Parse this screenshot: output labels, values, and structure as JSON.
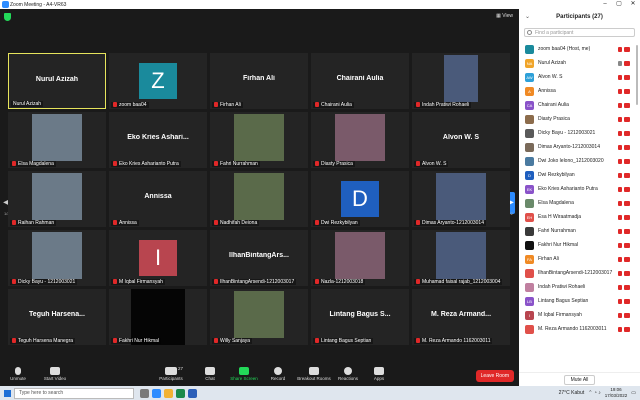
{
  "window": {
    "title": "Zoom Meeting - A4-VR63",
    "view_label": "View"
  },
  "tiles": [
    {
      "name": "Nurul Azizah",
      "label": "Nurul Azizah",
      "type": "name",
      "active": true,
      "muted": false
    },
    {
      "name": "",
      "label": "zoom baa04",
      "type": "letter",
      "letter": "Z",
      "color": "#1a8a9c",
      "muted": true
    },
    {
      "name": "Firhan Ali",
      "label": "Firhan Ali",
      "type": "name",
      "muted": true
    },
    {
      "name": "Chairani Aulia",
      "label": "Chairani Aulia",
      "type": "name",
      "muted": true
    },
    {
      "name": "",
      "label": "Indah Pratiwi Rohaeli",
      "type": "photo",
      "muted": true
    },
    {
      "name": "",
      "label": "Elsa Magdalena",
      "type": "photo",
      "muted": true
    },
    {
      "name": "Eko Kries Ashari...",
      "label": "Eko Kries Asharianto Putra",
      "type": "name",
      "muted": true
    },
    {
      "name": "",
      "label": "Fahri Nurrahman",
      "type": "photo",
      "muted": true
    },
    {
      "name": "",
      "label": "Diasty Prasica",
      "type": "photo",
      "muted": true
    },
    {
      "name": "Alvon W. S",
      "label": "Alvon W. S",
      "type": "name",
      "muted": true
    },
    {
      "name": "",
      "label": "Raihan Rahman",
      "type": "photo",
      "muted": true
    },
    {
      "name": "Annissa",
      "label": "Annissa",
      "type": "name",
      "muted": true
    },
    {
      "name": "",
      "label": "Nadhifah Deiona",
      "type": "photo",
      "muted": true
    },
    {
      "name": "",
      "label": "Dwi Rezkybilyan",
      "type": "letter",
      "letter": "D",
      "color": "#1f5fbf",
      "muted": true
    },
    {
      "name": "",
      "label": "Dimas Aryanto-1212003014",
      "type": "photo",
      "muted": true
    },
    {
      "name": "",
      "label": "Dicky Bayu - 1212003021",
      "type": "photo",
      "muted": true
    },
    {
      "name": "",
      "label": "M Iqbal Firmansyah",
      "type": "letter",
      "letter": "I",
      "color": "#b8454f",
      "muted": true
    },
    {
      "name": "IlhanBintangArs...",
      "label": "IlhanBintangArsendi-1212003017",
      "type": "name",
      "muted": true
    },
    {
      "name": "",
      "label": "Nazla-1212003018",
      "type": "photo",
      "muted": true
    },
    {
      "name": "",
      "label": "Muhamad faisal rajab_1212003004",
      "type": "photo",
      "muted": true
    },
    {
      "name": "Teguh Harsena...",
      "label": "Teguh Harsena Manegra",
      "type": "name",
      "muted": true
    },
    {
      "name": "",
      "label": "Fakhri Nur Hikmal",
      "type": "black",
      "muted": true
    },
    {
      "name": "",
      "label": "Willy Sanjaya",
      "type": "photo",
      "muted": true
    },
    {
      "name": "Lintang Bagus S...",
      "label": "Lintang Bagus Septian",
      "type": "name",
      "muted": true
    },
    {
      "name": "M. Reza Armand...",
      "label": "M. Reza Armando 1162003011",
      "type": "name",
      "muted": true
    }
  ],
  "pages": {
    "left": "1/2",
    "right": "1/2"
  },
  "toolbar": {
    "unmute": "Unmute",
    "start_video": "Start Video",
    "participants": "Participants",
    "participants_count": "27",
    "chat": "Chat",
    "share": "Share Screen",
    "record": "Record",
    "breakout": "Breakout Rooms",
    "reactions": "Reactions",
    "apps": "Apps",
    "leave": "Leave Room"
  },
  "panel": {
    "title": "Participants (27)",
    "search_placeholder": "Find a participant",
    "mute_all": "Mute All",
    "participants": [
      {
        "initials": "",
        "name": "zoom baa04 (Host, me)",
        "color": "#1a8a9c"
      },
      {
        "initials": "NA",
        "name": "Nurul Azizah",
        "color": "#f0a52a"
      },
      {
        "initials": "AW",
        "name": "Alvon W. S",
        "color": "#2ea0d8"
      },
      {
        "initials": "A",
        "name": "Annissa",
        "color": "#f08a24"
      },
      {
        "initials": "CA",
        "name": "Chairani Aulia",
        "color": "#8a53c9"
      },
      {
        "initials": "",
        "name": "Diasty Prasica",
        "color": "#8c6c4c"
      },
      {
        "initials": "",
        "name": "Dicky Bayu - 1212003021",
        "color": "#5a5a5a"
      },
      {
        "initials": "",
        "name": "Dimas Aryanto-1212003014",
        "color": "#7a6a5a"
      },
      {
        "initials": "",
        "name": "Dwi Joko lelono_1212003020",
        "color": "#4a7aa0"
      },
      {
        "initials": "D",
        "name": "Dwi Rezkybilyan",
        "color": "#1f5fbf"
      },
      {
        "initials": "EK",
        "name": "Eko Kries Asharianto Putra",
        "color": "#8a53c9"
      },
      {
        "initials": "",
        "name": "Elsa Magdalena",
        "color": "#6a8a6a"
      },
      {
        "initials": "EH",
        "name": "Esa H Wiraatmadja",
        "color": "#e0504a"
      },
      {
        "initials": "",
        "name": "Fahri Nurrahman",
        "color": "#3a3a3a"
      },
      {
        "initials": "",
        "name": "Fakhri Nur Hikmal",
        "color": "#111111"
      },
      {
        "initials": "FA",
        "name": "Firhan Ali",
        "color": "#f08a24"
      },
      {
        "initials": "",
        "name": "IlhanBintangArsendi-1212003017",
        "color": "#e0504a"
      },
      {
        "initials": "",
        "name": "Indah Pratiwi Rohaeli",
        "color": "#c080a0"
      },
      {
        "initials": "LB",
        "name": "Lintang Bagus Septian",
        "color": "#8a53c9"
      },
      {
        "initials": "I",
        "name": "M Iqbal Firmansyah",
        "color": "#b8454f"
      },
      {
        "initials": "",
        "name": "M. Reza Armando 1162003011",
        "color": "#e0504a"
      }
    ]
  },
  "taskbar": {
    "search_placeholder": "Type here to search",
    "weather": "27°C Kabut",
    "time": "19:06",
    "date": "17/03/2022"
  }
}
